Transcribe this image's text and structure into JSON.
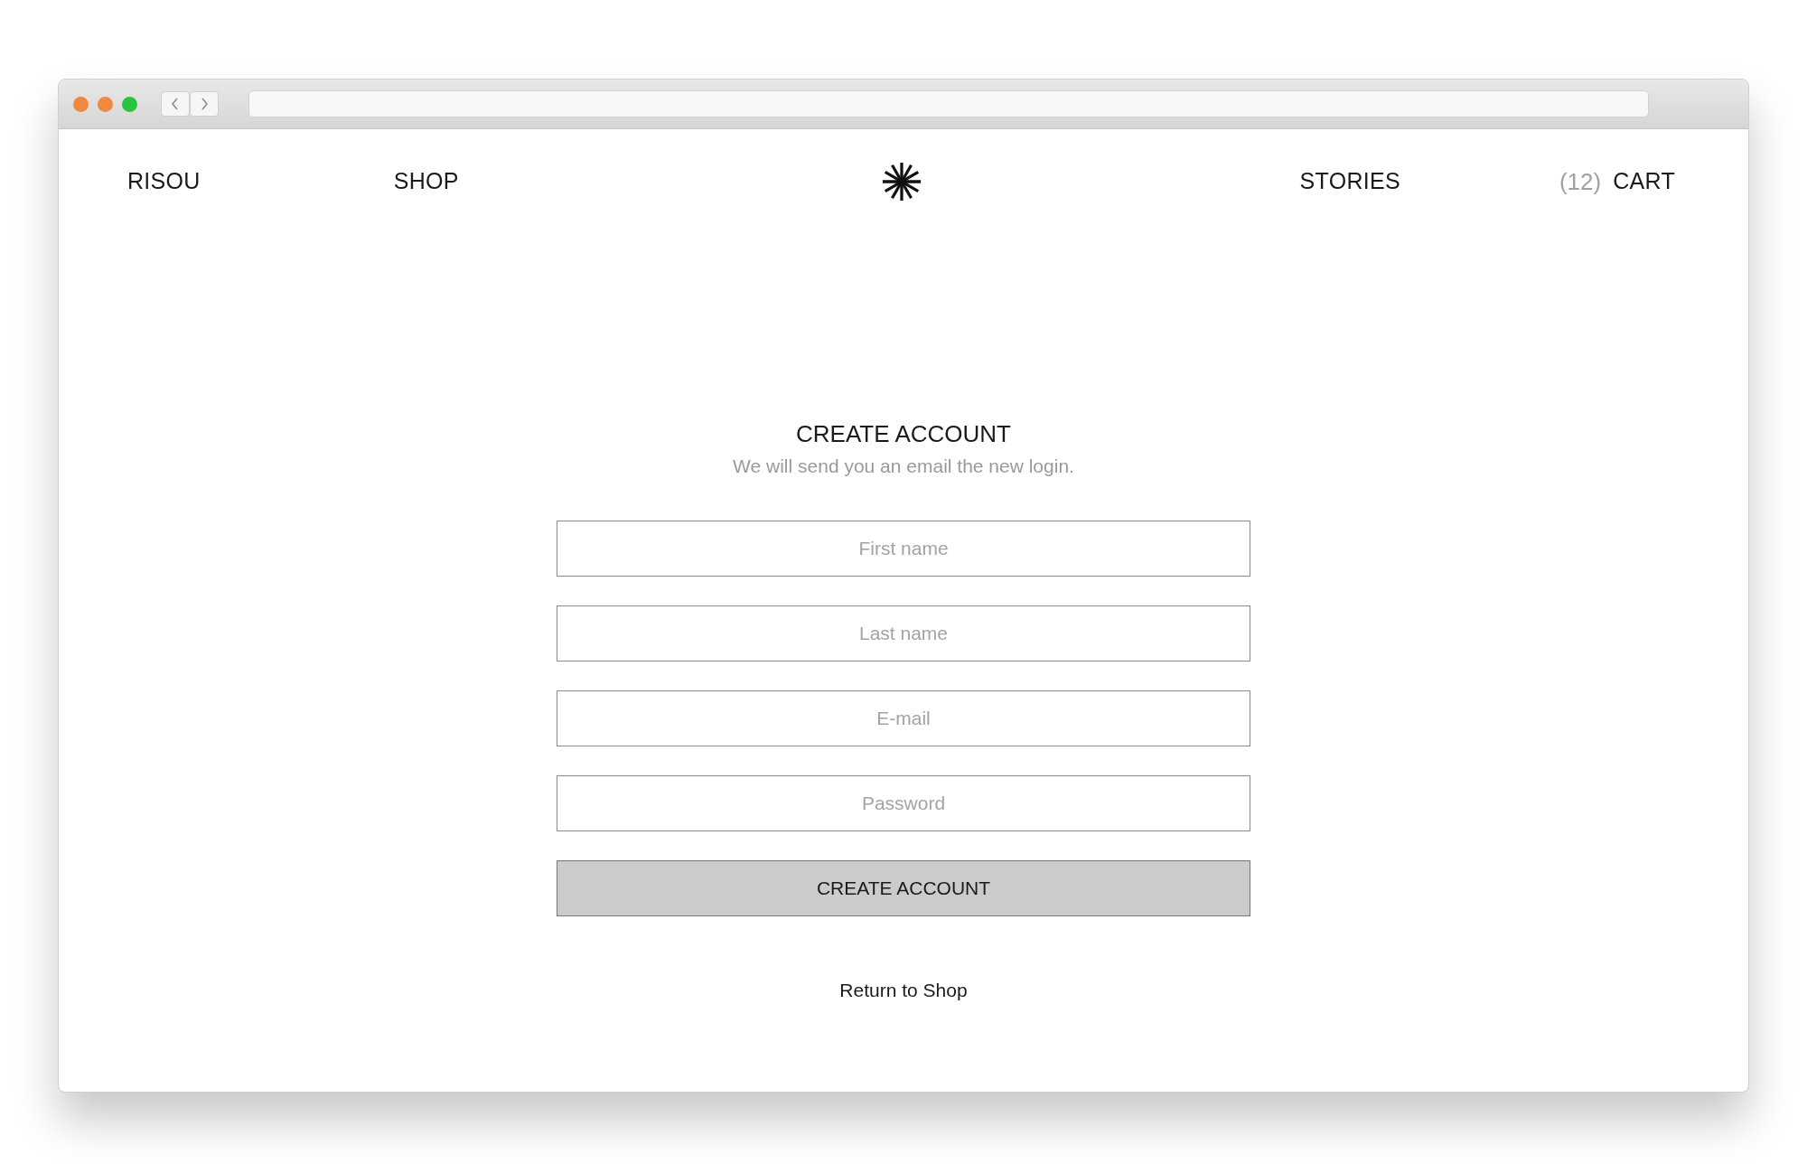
{
  "nav": {
    "brand": "RISOU",
    "left_links": [
      "SHOP"
    ],
    "right_links": [
      "STORIES"
    ],
    "cart": {
      "count": "(12)",
      "label": "CART"
    }
  },
  "form": {
    "title": "CREATE ACCOUNT",
    "subtitle": "We will send you an email the new login.",
    "fields": [
      {
        "placeholder": "First name"
      },
      {
        "placeholder": "Last name"
      },
      {
        "placeholder": "E-mail"
      },
      {
        "placeholder": "Password"
      }
    ],
    "button": "CREATE ACCOUNT",
    "link": "Return to Shop"
  }
}
